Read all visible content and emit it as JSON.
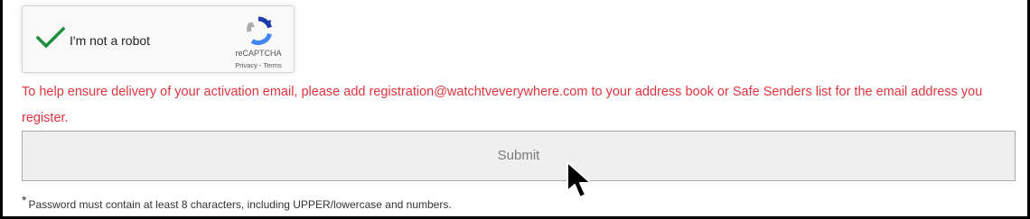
{
  "captcha": {
    "label": "I'm not a robot",
    "brand": "reCAPTCHA",
    "privacy_link": "Privacy",
    "separator": "-",
    "terms_link": "Terms",
    "checked": true,
    "check_icon": "checkmark-icon",
    "logo_icon": "recaptcha-logo-icon",
    "check_color": "#1e8e3e"
  },
  "notice": {
    "text": "To help ensure delivery of your activation email, please add registration@watchtveverywhere.com to your address book or Safe Senders list for the email address you register.",
    "color": "#e0343e"
  },
  "form": {
    "submit_label": "Submit"
  },
  "password_note": {
    "marker": "*",
    "text": "Password must contain at least 8 characters, including UPPER/lowercase and numbers."
  },
  "cursor": {
    "icon": "mouse-pointer-icon"
  }
}
